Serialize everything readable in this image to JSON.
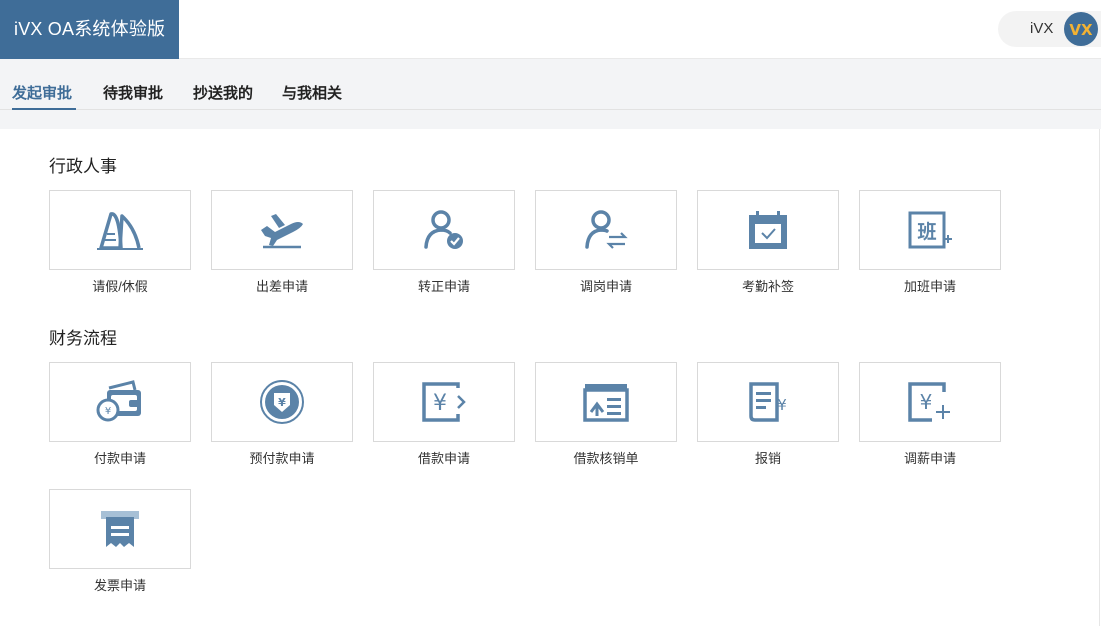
{
  "header": {
    "brand_title": "iVX OA系统体验版",
    "user_name": "iVX",
    "avatar_text": "VX"
  },
  "tabs": [
    {
      "label": "发起审批",
      "active": true
    },
    {
      "label": "待我审批",
      "active": false
    },
    {
      "label": "抄送我的",
      "active": false
    },
    {
      "label": "与我相关",
      "active": false
    }
  ],
  "sections": [
    {
      "title": "行政人事",
      "items": [
        {
          "label": "请假/休假",
          "icon": "leave-icon"
        },
        {
          "label": "出差申请",
          "icon": "plane-icon"
        },
        {
          "label": "转正申请",
          "icon": "user-check-icon"
        },
        {
          "label": "调岗申请",
          "icon": "user-transfer-icon"
        },
        {
          "label": "考勤补签",
          "icon": "calendar-check-icon"
        },
        {
          "label": "加班申请",
          "icon": "overtime-icon"
        }
      ]
    },
    {
      "title": "财务流程",
      "items": [
        {
          "label": "付款申请",
          "icon": "wallet-icon"
        },
        {
          "label": "预付款申请",
          "icon": "prepay-icon"
        },
        {
          "label": "借款申请",
          "icon": "loan-icon"
        },
        {
          "label": "借款核销单",
          "icon": "loan-writeoff-icon"
        },
        {
          "label": "报销",
          "icon": "reimburse-icon"
        },
        {
          "label": "调薪申请",
          "icon": "salary-adjust-icon"
        },
        {
          "label": "发票申请",
          "icon": "invoice-icon"
        }
      ]
    }
  ],
  "colors": {
    "brand": "#3f6d98",
    "icon": "#5b83a8",
    "tab_bg": "#f3f4f6"
  }
}
